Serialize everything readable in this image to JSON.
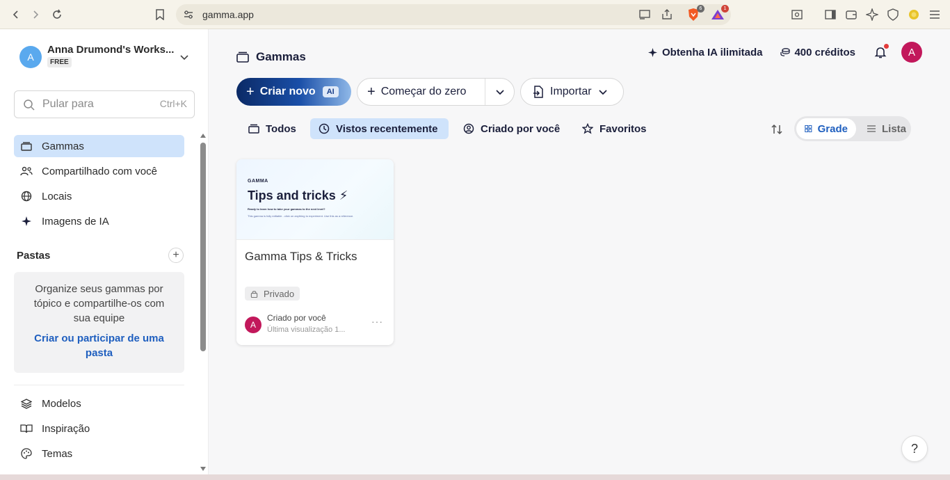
{
  "browser": {
    "url": "gamma.app",
    "brave_badge": "6",
    "rewards_badge": "1"
  },
  "workspace": {
    "avatar_letter": "A",
    "name": "Anna Drumond's Works...",
    "plan": "FREE"
  },
  "search": {
    "placeholder": "Pular para",
    "shortcut": "Ctrl+K"
  },
  "nav": {
    "gammas": "Gammas",
    "shared": "Compartilhado com você",
    "sites": "Locais",
    "ai_images": "Imagens de IA",
    "templates": "Modelos",
    "inspiration": "Inspiração",
    "themes": "Temas"
  },
  "folders": {
    "title": "Pastas",
    "description": "Organize seus gammas por tópico e compartilhe-os com sua equipe",
    "link": "Criar ou participar de uma pasta"
  },
  "header": {
    "title": "Gammas",
    "unlimited_ai": "Obtenha IA ilimitada",
    "credits": "400 créditos",
    "user_letter": "A"
  },
  "actions": {
    "create_new": "Criar novo",
    "ai_tag": "AI",
    "start_scratch": "Começar do zero",
    "import": "Importar"
  },
  "tabs": {
    "all": "Todos",
    "recent": "Vistos recentemente",
    "created_by_you": "Criado por você",
    "favorites": "Favoritos"
  },
  "view": {
    "grid": "Grade",
    "list": "Lista"
  },
  "card": {
    "thumb_brand": "GAMMA",
    "thumb_title": "Tips and tricks ⚡",
    "thumb_subtitle": "Ready to learn how to take your gammas to the next level?",
    "thumb_body": "This gamma is fully editable - click on anything to experiment. Use this as a reference.",
    "title": "Gamma Tips & Tricks",
    "privacy": "Privado",
    "avatar_letter": "A",
    "creator": "Criado por você",
    "viewed": "Última visualização 1...",
    "more": "···"
  },
  "help": "?",
  "colors": {
    "accent": "#1f5fbf",
    "active_bg": "#cfe3fb",
    "user_avatar": "#c2185b",
    "workspace_avatar": "#5aa9ee"
  }
}
